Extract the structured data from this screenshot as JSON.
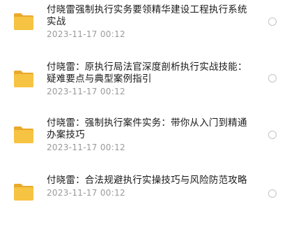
{
  "colors": {
    "folder": "#f6c342",
    "folder_tab": "#e9a92a",
    "title_text": "#1a1a1a",
    "date_text": "#9a9a9a",
    "radio_border": "#c4c4c4"
  },
  "items": [
    {
      "icon": "folder-icon",
      "title": "付晓雷强制执行实务要领精华建设工程执行系统实战",
      "date": "2023-11-17 00:12"
    },
    {
      "icon": "folder-icon",
      "title": "付晓雷：原执行局法官深度剖析执行实战技能：疑难要点与典型案例指引",
      "date": "2023-11-17 00:12"
    },
    {
      "icon": "folder-icon",
      "title": "付晓雷：强制执行案件实务：带你从入门到精通办案技巧",
      "date": "2023-11-17 00:12"
    },
    {
      "icon": "folder-icon",
      "title": "付晓雷：合法规避执行实操技巧与风险防范攻略",
      "date": "2023-11-17 00:12"
    }
  ]
}
